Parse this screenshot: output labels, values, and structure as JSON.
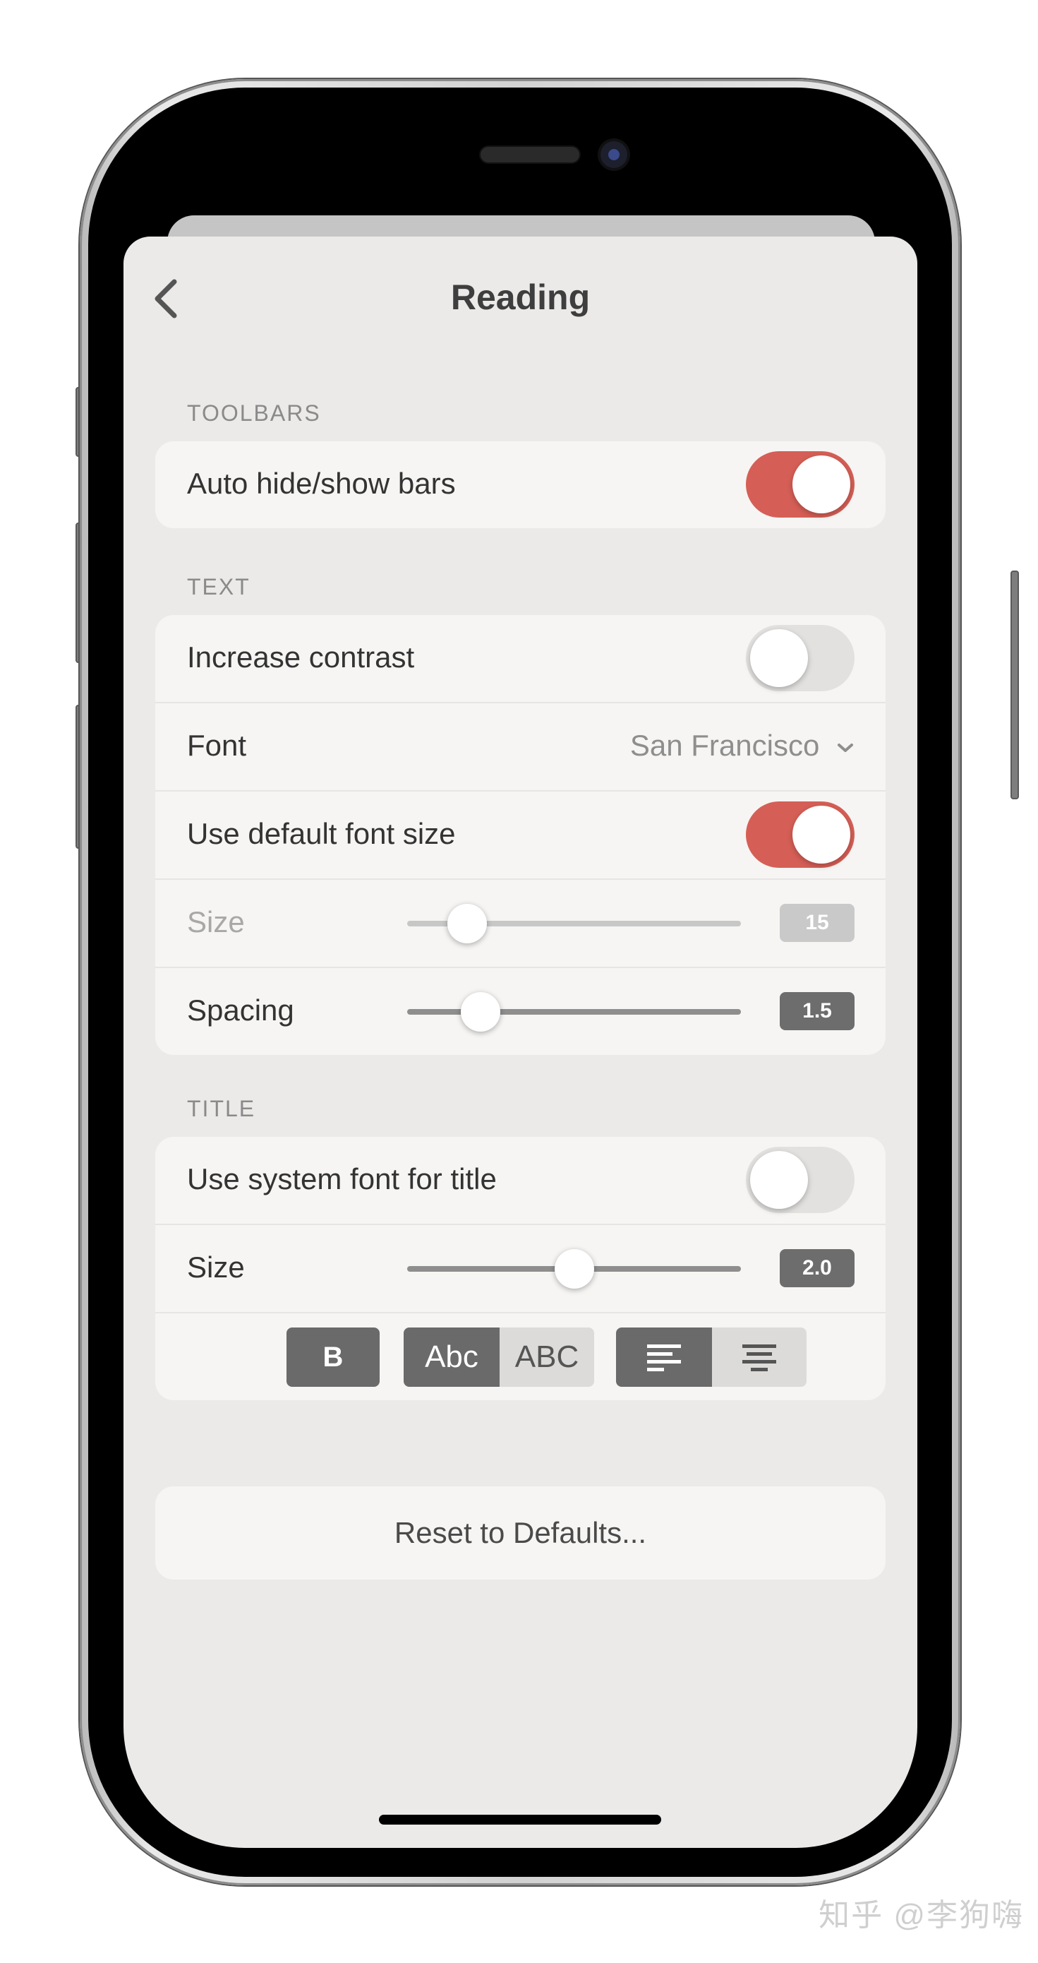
{
  "nav": {
    "title": "Reading"
  },
  "sections": {
    "toolbars": {
      "header": "TOOLBARS"
    },
    "text": {
      "header": "TEXT"
    },
    "title": {
      "header": "TITLE"
    }
  },
  "toolbars": {
    "auto_hide_label": "Auto hide/show bars",
    "auto_hide_on": true
  },
  "text": {
    "increase_contrast_label": "Increase contrast",
    "increase_contrast_on": false,
    "font_label": "Font",
    "font_value": "San Francisco",
    "default_size_label": "Use default font size",
    "default_size_on": true,
    "size_label": "Size",
    "size_value": "15",
    "spacing_label": "Spacing",
    "spacing_value": "1.5"
  },
  "title": {
    "system_font_label": "Use system font for title",
    "system_font_on": false,
    "size_label": "Size",
    "size_value": "2.0",
    "bold_label": "B",
    "case_options": [
      "Abc",
      "ABC"
    ],
    "selected_case": "Abc",
    "alignment_options": [
      "left-align-icon",
      "center-align-icon"
    ],
    "selected_alignment": "left"
  },
  "reset_label": "Reset to Defaults...",
  "colors": {
    "accent": "#d55f56",
    "badge": "#6d6d6d",
    "background": "#ebeae8"
  },
  "watermark": "知乎 @李狗嗨"
}
